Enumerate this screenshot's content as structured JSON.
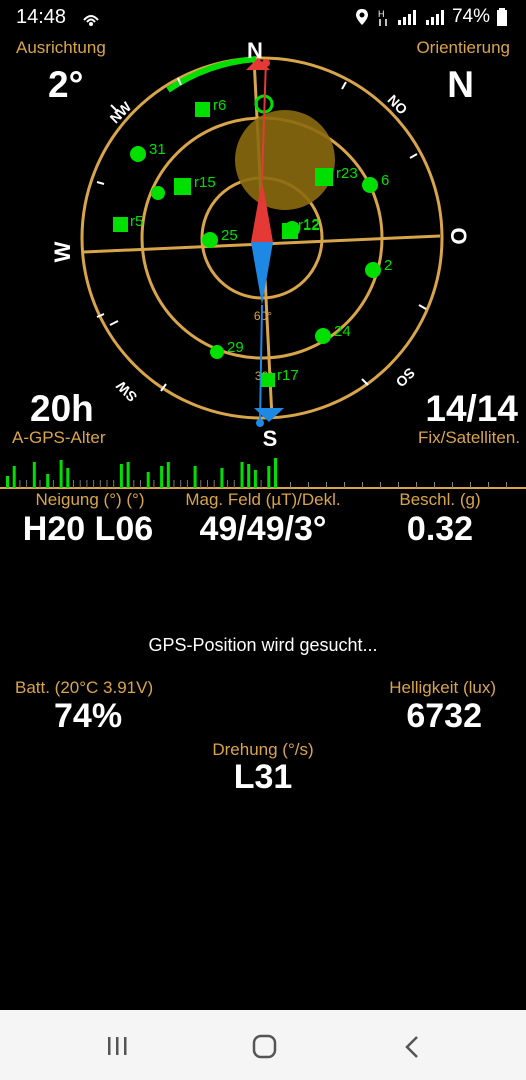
{
  "status": {
    "time": "14:48",
    "battery": "74%"
  },
  "top": {
    "left_label": "Ausrichtung",
    "left_value": "2°",
    "right_label": "Orientierung",
    "right_value": "N",
    "age_value": "20h",
    "age_label": "A-GPS-Alter",
    "fix_value": "14/14",
    "fix_label": "Fix/Satelliten."
  },
  "compass": {
    "directions": {
      "n": "N",
      "s": "S",
      "w": "W",
      "o": "O",
      "nw": "NW",
      "no": "NO",
      "sw": "SW",
      "so": "SO"
    },
    "elev_labels": [
      "60°",
      "30°"
    ],
    "satellites": [
      {
        "id": "r6",
        "shape": "square"
      },
      {
        "id": "31",
        "shape": "circle"
      },
      {
        "id": "r15",
        "shape": "square"
      },
      {
        "id": "r5",
        "shape": "square"
      },
      {
        "id": "25",
        "shape": "circle"
      },
      {
        "id": "r23",
        "shape": "square"
      },
      {
        "id": "6",
        "shape": "circle"
      },
      {
        "id": "12",
        "shape": "circle"
      },
      {
        "id": "r12",
        "shape": "square"
      },
      {
        "id": "2",
        "shape": "circle"
      },
      {
        "id": "24",
        "shape": "circle"
      },
      {
        "id": "29",
        "shape": "circle"
      },
      {
        "id": "r17",
        "shape": "square"
      }
    ],
    "colors": {
      "ring": "#d9a54a",
      "sat": "#00e000",
      "needle_n": "#e53935",
      "needle_s": "#1e88e5",
      "arc": "#00e000"
    }
  },
  "signal_bars": [
    12,
    22,
    0,
    0,
    26,
    0,
    14,
    0,
    28,
    20,
    0,
    0,
    0,
    0,
    0,
    0,
    0,
    24,
    26,
    0,
    0,
    16,
    0,
    22,
    26,
    0,
    0,
    0,
    22,
    0,
    0,
    0,
    20,
    0,
    0,
    26,
    24,
    18,
    0,
    22,
    30
  ],
  "sensors": {
    "tilt_label": "Neigung (°) (°)",
    "tilt_value": "H20 L06",
    "mag_label": "Mag. Feld (µT)/Dekl.",
    "mag_value": "49/49/3°",
    "accel_label": "Beschl. (g)",
    "accel_value": "0.32"
  },
  "gps_status": "GPS-Position wird gesucht...",
  "battery": {
    "label": "Batt. (20°C 3.91V)",
    "value": "74%"
  },
  "light": {
    "label": "Helligkeit (lux)",
    "value": "6732"
  },
  "rotation": {
    "label": "Drehung (°/s)",
    "value": "L31"
  }
}
